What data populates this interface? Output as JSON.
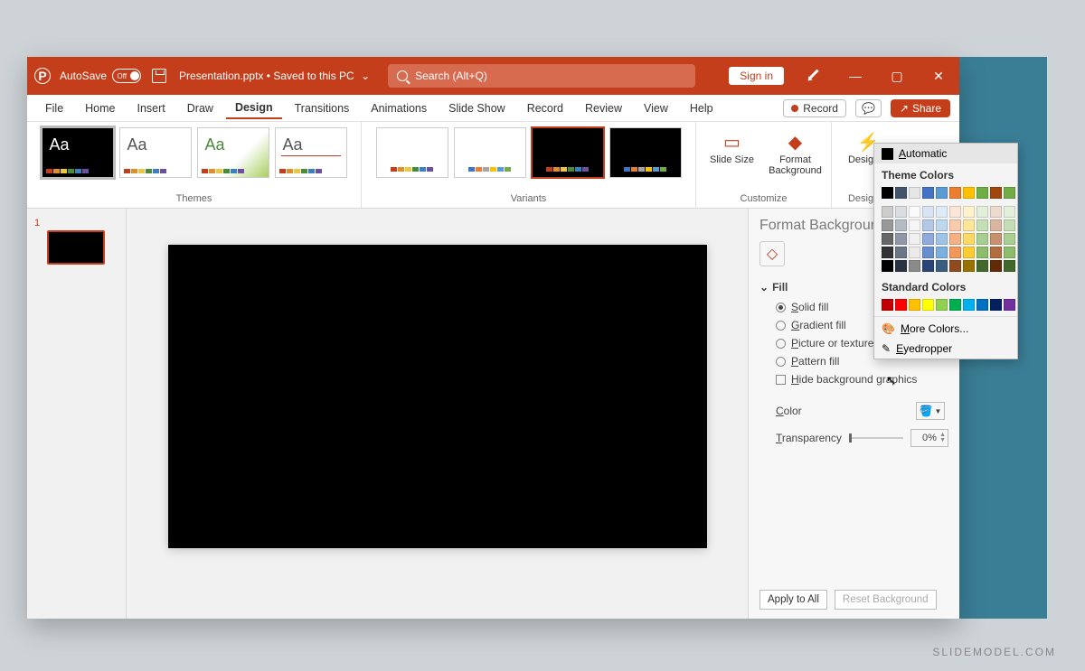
{
  "titlebar": {
    "autosave_label": "AutoSave",
    "autosave_state": "Off",
    "doc_name": "Presentation.pptx",
    "doc_status": "Saved to this PC",
    "search_placeholder": "Search (Alt+Q)",
    "signin": "Sign in"
  },
  "tabs": [
    "File",
    "Home",
    "Insert",
    "Draw",
    "Design",
    "Transitions",
    "Animations",
    "Slide Show",
    "Record",
    "Review",
    "View",
    "Help"
  ],
  "active_tab": "Design",
  "menubar": {
    "record": "Record",
    "share": "Share"
  },
  "ribbon": {
    "themes_label": "Themes",
    "variants_label": "Variants",
    "customize_label": "Customize",
    "designer_label": "Designer",
    "slide_size": "Slide Size",
    "format_bg": "Format Background",
    "designer": "Designer"
  },
  "pane": {
    "title": "Format Background",
    "section": "Fill",
    "solid": "Solid fill",
    "gradient": "Gradient fill",
    "picture": "Picture or texture fill",
    "pattern": "Pattern fill",
    "hide": "Hide background graphics",
    "color": "Color",
    "transparency": "Transparency",
    "transparency_value": "0%",
    "apply": "Apply to All",
    "reset": "Reset Background"
  },
  "popup": {
    "automatic": "Automatic",
    "theme": "Theme Colors",
    "standard": "Standard Colors",
    "more": "More Colors...",
    "eyedropper": "Eyedropper",
    "theme_colors": [
      "#000000",
      "#44546a",
      "#e7e6e6",
      "#4472c4",
      "#5b9bd5",
      "#ed7d31",
      "#ffc000",
      "#70ad47",
      "#9e480e",
      "#70ad47"
    ],
    "standard_colors": [
      "#c00000",
      "#ff0000",
      "#ffc000",
      "#ffff00",
      "#92d050",
      "#00b050",
      "#00b0f0",
      "#0070c0",
      "#002060",
      "#7030a0"
    ]
  },
  "slide_number": "1",
  "watermark": "SLIDEMODEL.COM",
  "palette_bars": {
    "a": [
      "#c43e1c",
      "#e08e2b",
      "#eac645",
      "#4a8b3b",
      "#3a7fbf",
      "#6b4fa0"
    ],
    "b": [
      "#4472c4",
      "#ed7d31",
      "#a5a5a5",
      "#ffc000",
      "#5b9bd5",
      "#70ad47"
    ]
  }
}
